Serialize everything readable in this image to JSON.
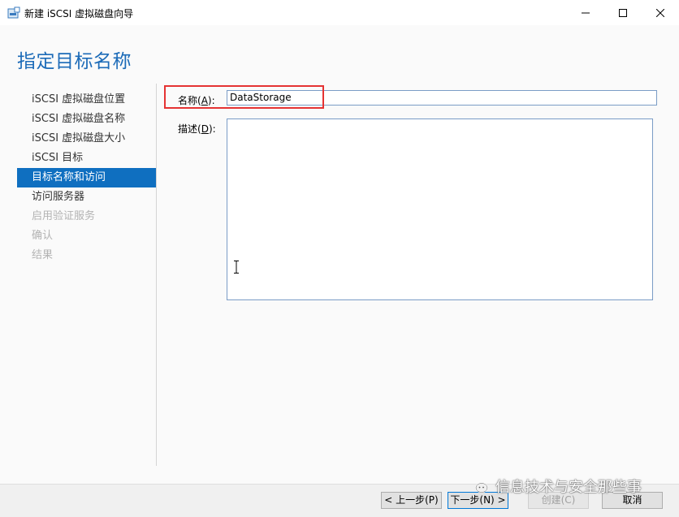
{
  "window": {
    "title": "新建 iSCSI 虚拟磁盘向导",
    "controls": [
      "minimize-icon",
      "maximize-icon",
      "close-icon"
    ]
  },
  "page": {
    "heading": "指定目标名称"
  },
  "nav": {
    "items": [
      {
        "label": "iSCSI 虚拟磁盘位置",
        "state": "normal"
      },
      {
        "label": "iSCSI 虚拟磁盘名称",
        "state": "normal"
      },
      {
        "label": "iSCSI 虚拟磁盘大小",
        "state": "normal"
      },
      {
        "label": "iSCSI 目标",
        "state": "normal"
      },
      {
        "label": "目标名称和访问",
        "state": "active"
      },
      {
        "label": "访问服务器",
        "state": "normal"
      },
      {
        "label": "启用验证服务",
        "state": "disabled"
      },
      {
        "label": "确认",
        "state": "disabled"
      },
      {
        "label": "结果",
        "state": "disabled"
      }
    ]
  },
  "form": {
    "name_label": "名称(",
    "name_label_key": "A",
    "name_label_end": "):",
    "name_value": "DataStorage",
    "desc_label": "描述(",
    "desc_label_key": "D",
    "desc_label_end": "):",
    "desc_value": ""
  },
  "buttons": {
    "prev": "< 上一步(P)",
    "next": "下一步(N) >",
    "create": "创建(C)",
    "cancel": "取消"
  },
  "watermark": {
    "text": "信息技术与安全那些事"
  },
  "colors": {
    "accent": "#0f6fc0",
    "heading": "#1c6bb8",
    "highlight": "#e53333"
  }
}
